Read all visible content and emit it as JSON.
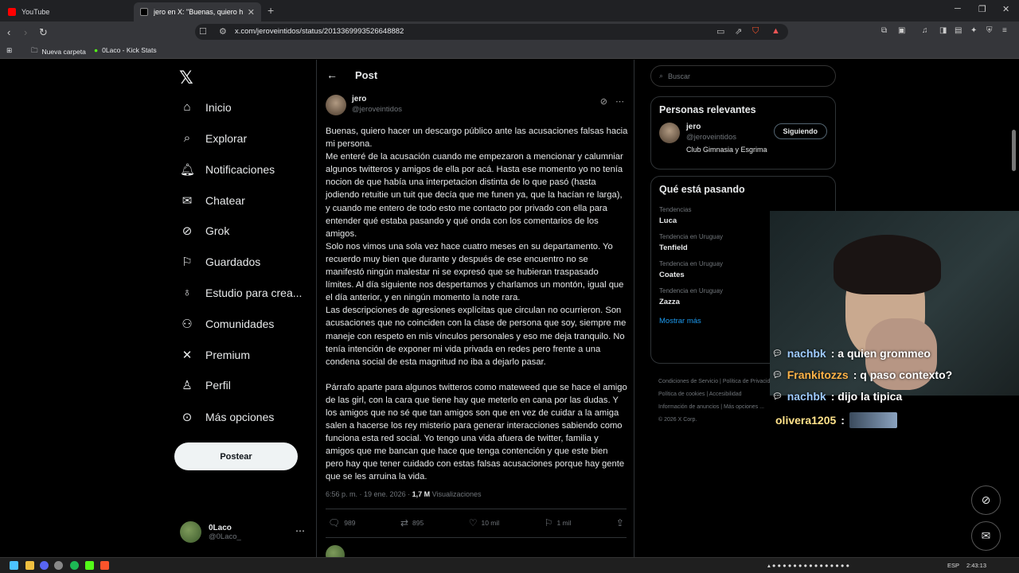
{
  "browser": {
    "tabs": [
      {
        "title": "YouTube",
        "color": "#ff0000"
      },
      {
        "title": "jero en X: \"Buenas, quiero hacer",
        "color": "#ffffff"
      }
    ],
    "url": "x.com/jeroveintidos/status/2013369993526648882",
    "bookmarks": [
      "Nueva carpeta",
      "0Laco - Kick Stats"
    ]
  },
  "nav": {
    "items": [
      "Inicio",
      "Explorar",
      "Notificaciones",
      "Chatear",
      "Grok",
      "Guardados",
      "Estudio para crea...",
      "Comunidades",
      "Premium",
      "Perfil",
      "Más opciones"
    ],
    "post_button": "Postear",
    "user_name": "0Laco",
    "user_handle": "@0Laco_"
  },
  "post": {
    "header": "Post",
    "author_name": "jero",
    "author_handle": "@jeroveintidos",
    "paragraphs": [
      "Buenas, quiero hacer un descargo público ante las acusaciones falsas hacia mi persona.",
      "Me enteré de la acusación cuando me empezaron a mencionar y calumniar algunos twitteros y amigos de ella por acá. Hasta ese momento yo no tenía nocion de que había una interpetacion distinta de lo que pasó (hasta jodiendo retuitie un tuit que decía que me funen ya, que la hacían re larga), y cuando me entero de todo esto me contacto por privado con ella para entender qué estaba pasando y qué onda con los comentarios de los amigos.",
      "Solo nos vimos una sola vez hace cuatro meses en su departamento. Yo recuerdo muy bien que durante y después de ese encuentro no se manifestó ningún malestar ni se expresó que se hubieran traspasado límites. Al día siguiente nos despertamos y charlamos un montón, igual que el día anterior, y en ningún momento la note rara.",
      "Las descripciones de agresiones explícitas que circulan no ocurrieron. Son acusaciones que no coinciden con la clase de persona que soy, siempre me maneje con respeto en mis vínculos personales y eso me deja tranquilo. No tenía intención de exponer mi vida privada en redes pero frente a una condena social de esta magnitud no iba a dejarlo pasar.",
      "",
      "Párrafo aparte para algunos twitteros como mateweed que se hace el amigo de las girl, con la cara que tiene hay que meterlo en cana por las dudas. Y los amigos que no sé que tan amigos son que en vez de cuidar a la amiga salen a hacerse los rey misterio para generar interacciones sabiendo como funciona esta red social. Yo tengo una vida afuera de twitter, familia y amigos que me bancan que hace que tenga contención y que este bien pero hay que tener cuidado con estas falsas acusaciones porque hay gente que se les arruina la vida."
    ],
    "time": "6:56 p. m.",
    "date": "19 ene. 2026",
    "views_count": "1,7 M",
    "views_label": "Visualizaciones",
    "replies": "989",
    "reposts": "895",
    "likes": "10 mil",
    "bookmarks": "1 mil"
  },
  "sidebar": {
    "search_placeholder": "Buscar",
    "relevant_title": "Personas relevantes",
    "relevant_name": "jero",
    "relevant_handle": "@jeroveintidos",
    "relevant_bio": "Club Gimnasia y Esgrima",
    "follow_label": "Siguiendo",
    "trending_title": "Qué está pasando",
    "trends": [
      {
        "context": "Tendencias",
        "name": "Luca"
      },
      {
        "context": "Tendencia en Uruguay",
        "name": "Tenfield"
      },
      {
        "context": "Tendencia en Uruguay",
        "name": "Coates"
      },
      {
        "context": "Tendencia en Uruguay",
        "name": "Zazza"
      }
    ],
    "show_more": "Mostrar más",
    "footer": [
      "Condiciones de Servicio",
      "Política de Privacidad",
      "Política de cookies",
      "Accesibilidad",
      "Información de anuncios",
      "Más opciones ...",
      "© 2026 X Corp."
    ]
  },
  "chat": [
    {
      "user": "nachbk",
      "message": ": a quien grommeo"
    },
    {
      "user": "Frankitozzs",
      "message": ": q paso contexto?"
    },
    {
      "user": "nachbk",
      "message": ": dijo la tipica"
    },
    {
      "user": "olivera1205",
      "message": ":"
    }
  ],
  "taskbar": {
    "lang": "ESP",
    "clock": "2:43:13"
  }
}
